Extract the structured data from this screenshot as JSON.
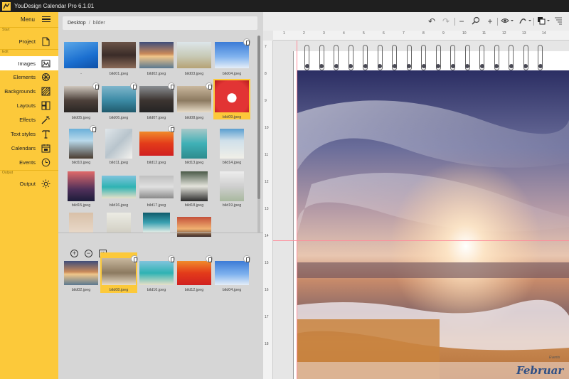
{
  "window": {
    "title": "YouDesign Calendar Pro 6.1.01"
  },
  "sidebar": {
    "menu_label": "Menu",
    "section_start": "Start",
    "section_edit": "Edit",
    "section_output": "Output",
    "items": [
      {
        "label": "Project",
        "icon": "document-icon"
      },
      {
        "label": "Images",
        "icon": "image-icon",
        "active": true
      },
      {
        "label": "Elements",
        "icon": "elements-icon"
      },
      {
        "label": "Backgrounds",
        "icon": "backgrounds-icon"
      },
      {
        "label": "Layouts",
        "icon": "layouts-icon"
      },
      {
        "label": "Effects",
        "icon": "magic-wand-icon"
      },
      {
        "label": "Text styles",
        "icon": "text-icon"
      },
      {
        "label": "Calendars",
        "icon": "calendar-icon"
      },
      {
        "label": "Events",
        "icon": "clock-icon"
      },
      {
        "label": "Output",
        "icon": "sun-icon"
      }
    ],
    "accent_color": "#fcc93a"
  },
  "browser": {
    "breadcrumb": {
      "root": "Desktop",
      "separator": "/",
      "current": "bilder"
    },
    "files": [
      {
        "name": "-",
        "checked": false
      },
      {
        "name": "bild01.jpeg",
        "checked": false
      },
      {
        "name": "bild02.jpeg",
        "checked": false
      },
      {
        "name": "bild03.jpeg",
        "checked": false
      },
      {
        "name": "bild04.jpeg",
        "checked": true
      },
      {
        "name": "bild05.jpeg",
        "checked": true
      },
      {
        "name": "bild06.jpeg",
        "checked": true
      },
      {
        "name": "bild07.jpeg",
        "checked": true
      },
      {
        "name": "bild08.jpeg",
        "checked": true
      },
      {
        "name": "bild09.jpeg",
        "checked": false,
        "selected": true
      },
      {
        "name": "bild10.jpeg",
        "checked": true
      },
      {
        "name": "bild11.jpeg",
        "checked": false
      },
      {
        "name": "bild12.jpeg",
        "checked": true
      },
      {
        "name": "bild13.jpeg",
        "checked": false
      },
      {
        "name": "bild14.jpeg",
        "checked": false
      },
      {
        "name": "bild15.jpeg",
        "checked": false
      },
      {
        "name": "bild16.jpeg",
        "checked": false
      },
      {
        "name": "bild17.jpeg",
        "checked": false
      },
      {
        "name": "bild18.jpeg",
        "checked": false
      },
      {
        "name": "bild19.jpeg",
        "checked": false
      },
      {
        "name": "",
        "checked": false
      },
      {
        "name": "",
        "checked": false
      },
      {
        "name": "",
        "checked": false
      },
      {
        "name": "",
        "checked": false
      }
    ],
    "collection_buttons": [
      "add-icon",
      "remove-icon",
      "clear-icon"
    ],
    "collection": [
      {
        "name": "bild02.jpeg",
        "checked": false
      },
      {
        "name": "bild08.jpeg",
        "checked": true,
        "selected": true
      },
      {
        "name": "bild16.jpeg",
        "checked": true
      },
      {
        "name": "bild12.jpeg",
        "checked": true
      },
      {
        "name": "bild04.jpeg",
        "checked": true
      }
    ]
  },
  "editor": {
    "toolbar": [
      "undo-icon",
      "redo-icon",
      "zoom-out-icon",
      "zoom-icon",
      "zoom-in-icon",
      "view-icon",
      "effects-icon",
      "layer-icon",
      "arrange-icon"
    ],
    "ruler_top": [
      "1",
      "2",
      "3",
      "4",
      "5",
      "6",
      "7",
      "8",
      "9",
      "10",
      "11",
      "12",
      "13",
      "14"
    ],
    "ruler_left": [
      "7",
      "8",
      "9",
      "10",
      "11",
      "12",
      "13",
      "14",
      "15",
      "16",
      "17",
      "18"
    ],
    "month": "Februar",
    "events_tag": "Events"
  }
}
